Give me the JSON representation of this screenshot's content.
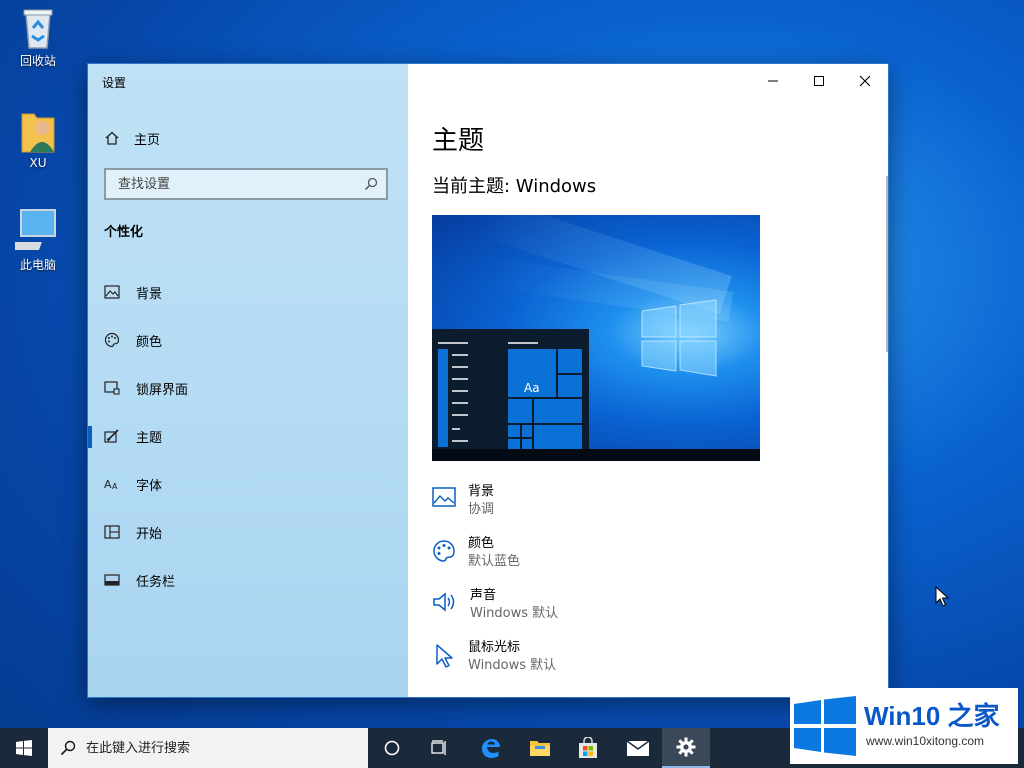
{
  "desktop": {
    "icons": [
      {
        "label": "回收站",
        "icon": "recycle-bin-icon"
      },
      {
        "label": "XU",
        "icon": "user-folder-icon"
      },
      {
        "label": "此电脑",
        "icon": "this-pc-icon"
      }
    ]
  },
  "window": {
    "app_title": "设置",
    "controls": {
      "minimize": "minimize-icon",
      "maximize": "maximize-icon",
      "close": "close-icon"
    },
    "sidebar": {
      "home_label": "主页",
      "search_placeholder": "查找设置",
      "section_title": "个性化",
      "items": [
        {
          "label": "背景",
          "icon": "image-icon"
        },
        {
          "label": "颜色",
          "icon": "palette-icon"
        },
        {
          "label": "锁屏界面",
          "icon": "lock-screen-icon"
        },
        {
          "label": "主题",
          "icon": "theme-brush-icon",
          "active": true
        },
        {
          "label": "字体",
          "icon": "font-icon"
        },
        {
          "label": "开始",
          "icon": "start-menu-icon"
        },
        {
          "label": "任务栏",
          "icon": "taskbar-icon"
        }
      ]
    },
    "main": {
      "title": "主题",
      "current_theme": "当前主题: Windows",
      "preview_tile_text": "Aa",
      "items": [
        {
          "title": "背景",
          "value": "协调",
          "icon": "image-icon"
        },
        {
          "title": "颜色",
          "value": "默认蓝色",
          "icon": "palette-icon"
        },
        {
          "title": "声音",
          "value": "Windows 默认",
          "icon": "speaker-icon"
        },
        {
          "title": "鼠标光标",
          "value": "Windows 默认",
          "icon": "pointer-icon"
        }
      ]
    }
  },
  "taskbar": {
    "search_placeholder": "在此键入进行搜索",
    "apps": [
      "cortana-icon",
      "task-view-icon",
      "edge-icon",
      "file-explorer-icon",
      "store-icon",
      "mail-icon",
      "settings-icon"
    ]
  },
  "watermark": {
    "brand": "Win10 之家",
    "url": "www.win10xitong.com"
  },
  "colors": {
    "accent": "#0a5fc4",
    "sidebar_bg": "#b5dcf4",
    "taskbar_bg": "#1b2a3a"
  }
}
